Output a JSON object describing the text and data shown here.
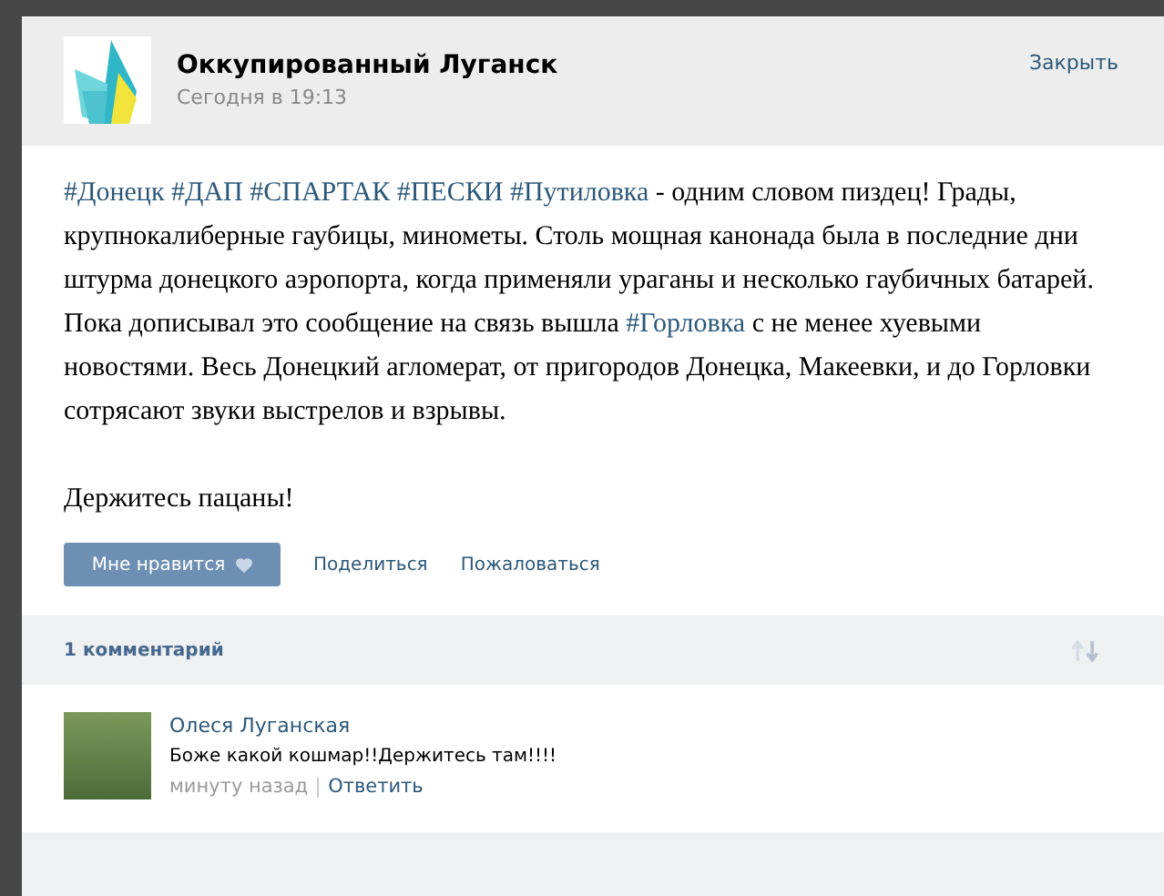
{
  "post": {
    "author": "Оккупированный Луганск",
    "time": "Сегодня в 19:13",
    "close": "Закрыть",
    "paragraphs": [
      [
        {
          "kind": "tag",
          "text": "#Донецк"
        },
        {
          "kind": "tag",
          "text": "#ДАП"
        },
        {
          "kind": "tag",
          "text": "#СПАРТАК"
        },
        {
          "kind": "tag",
          "text": "#ПЕСКИ"
        },
        {
          "kind": "tag",
          "text": "#Путиловка"
        },
        {
          "kind": "text",
          "text": " - одним словом пиздец! Грады, крупнокалиберные гаубицы, минометы. Столь мощная канонада была в последние дни штурма донецкого аэропорта, когда применяли ураганы и несколько гаубичных батарей. Пока дописывал это сообщение на связь вышла "
        },
        {
          "kind": "tag",
          "text": "#Горловка"
        },
        {
          "kind": "text",
          "text": " с не менее хуевыми новостями. Весь Донецкий агломерат, от пригородов Донецка, Макеевки, и до Горловки сотрясают звуки выстрелов и взрывы."
        }
      ],
      [
        {
          "kind": "text",
          "text": "Держитесь пацаны!"
        }
      ]
    ],
    "actions": {
      "like": "Мне нравится",
      "share": "Поделиться",
      "report": "Пожаловаться"
    }
  },
  "comments": {
    "count": "1 комментарий",
    "items": [
      {
        "author": "Олеся Луганская",
        "text": "Боже какой кошмар!!Держитесь там!!!!",
        "time": "минуту назад",
        "reply": "Ответить"
      }
    ]
  }
}
